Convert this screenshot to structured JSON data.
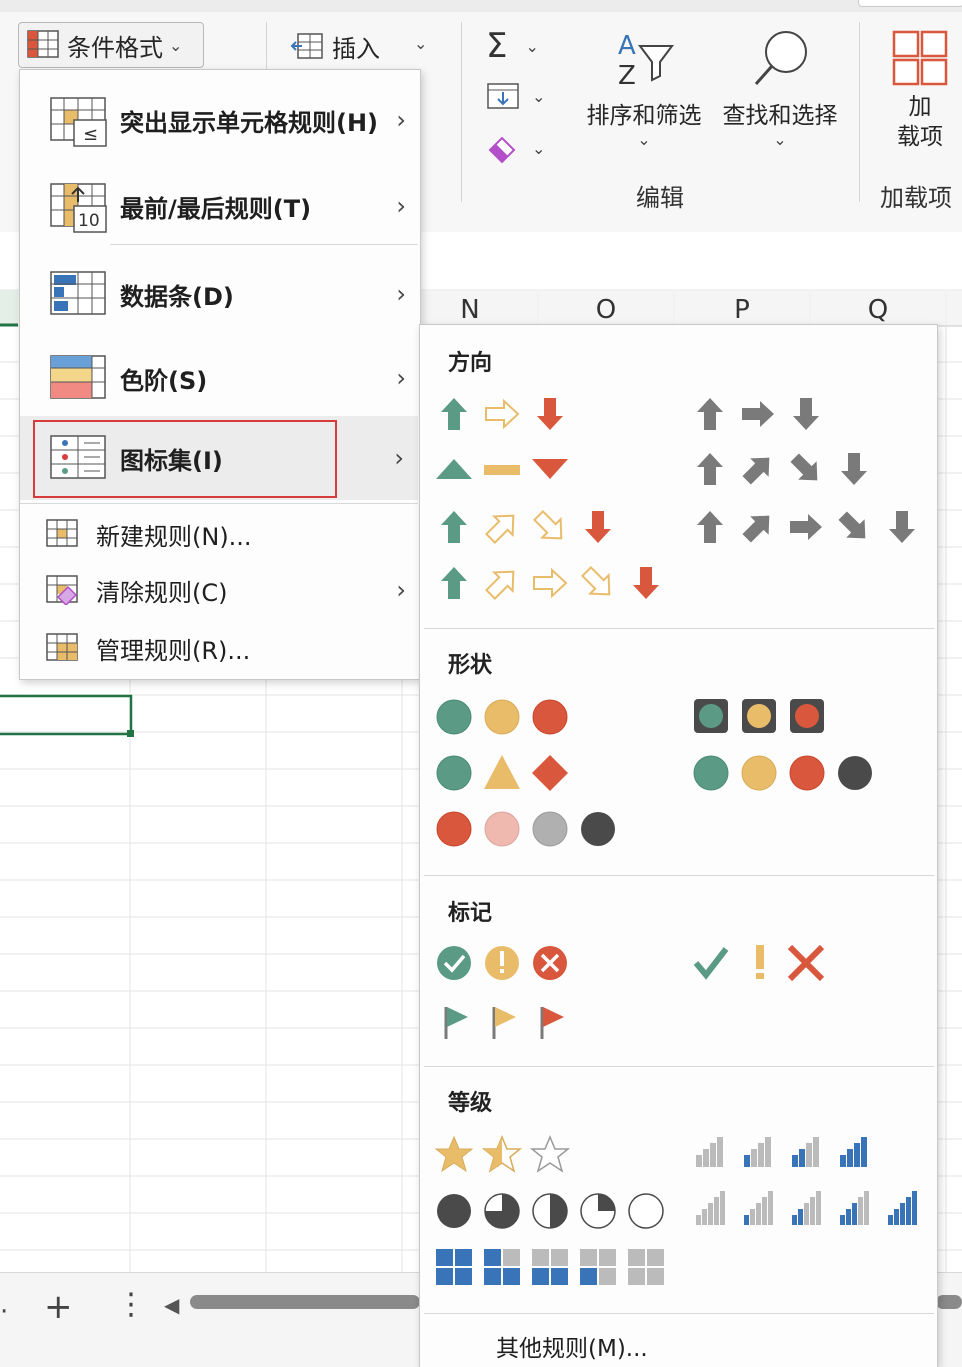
{
  "ribbon": {
    "cond_format_label": "条件格式",
    "insert_label": "插入",
    "sort_filter_label": "排序和筛选",
    "find_select_label": "查找和选择",
    "addins_line1": "加",
    "addins_line2": "载项",
    "group_edit": "编辑",
    "group_addins": "加载项"
  },
  "columns": [
    "N",
    "O",
    "P",
    "Q"
  ],
  "cf_menu": {
    "items": [
      {
        "label": "突出显示单元格规则(H)",
        "hotkey": "H"
      },
      {
        "label": "最前/最后规则(T)",
        "hotkey": "T"
      },
      {
        "label": "数据条(D)",
        "hotkey": "D"
      },
      {
        "label": "色阶(S)",
        "hotkey": "S"
      },
      {
        "label": "图标集(I)",
        "hotkey": "I"
      },
      {
        "label": "新建规则(N)...",
        "hotkey": "N"
      },
      {
        "label": "清除规则(C)",
        "hotkey": "C"
      },
      {
        "label": "管理规则(R)...",
        "hotkey": "R"
      }
    ],
    "top10_icon_text": "10",
    "highlight_icon_text": "≤"
  },
  "iconset_menu": {
    "section_direction": "方向",
    "section_shapes": "形状",
    "section_indicators": "标记",
    "section_ratings": "等级",
    "more_rules": "其他规则(M)..."
  },
  "colors": {
    "green": "#5b9b86",
    "yellow": "#e9bc6a",
    "red": "#d9573c",
    "gray": "#7a7a7a",
    "dark": "#4a4a4a",
    "blue": "#3a74b8",
    "highlight_border": "#d83b3b",
    "excel_green": "#217346"
  }
}
